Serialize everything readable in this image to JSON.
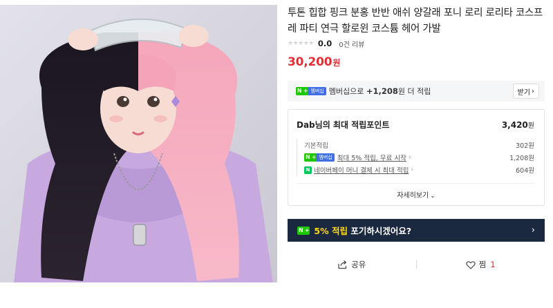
{
  "product": {
    "title": "투톤 힙합 핑크 분홍 반반 애쉬 양갈래 포니 로리 로리타 코스프레 파티 연극 할로윈 코스튬 헤어 가발",
    "stars": "★★★★★",
    "score": "0.0",
    "reviews": "0건 리뷰",
    "price": "30,200",
    "price_unit": "원"
  },
  "membership": {
    "badge_n": "N",
    "badge_plus": "+",
    "badge_label": "멤버십",
    "text_prefix": "멤버십으로 ",
    "amount": "+1,208",
    "text_suffix": "원 더 적립",
    "button_label": "받기",
    "button_chev": "›"
  },
  "points": {
    "title": "Dab님의 최대 적립포인트",
    "total": "3,420",
    "total_unit": "원",
    "basic_label": "기본적립",
    "basic_value": "302원",
    "member_label": "최대 5% 적립, 무료 시작",
    "member_value": "1,208원",
    "npay_icon": "N",
    "npay_label": "네이버페이 머니 결제 시 최대 적립",
    "npay_value": "604원",
    "more_label": "자세히보기",
    "chev": "›",
    "more_chev": "⌄"
  },
  "banner": {
    "highlight": "5% 적립",
    "text": " 포기하시겠어요?",
    "chev": "›"
  },
  "actions": {
    "share_label": "공유",
    "wish_label": "찜",
    "wish_count": "1"
  },
  "colors": {
    "price": "#e62d35",
    "naver_green": "#1ec800",
    "banner_bg": "#1b2940",
    "banner_highlight": "#ffd919"
  },
  "icons": {
    "share": "share-icon",
    "heart": "heart-icon",
    "star": "star-icon"
  }
}
